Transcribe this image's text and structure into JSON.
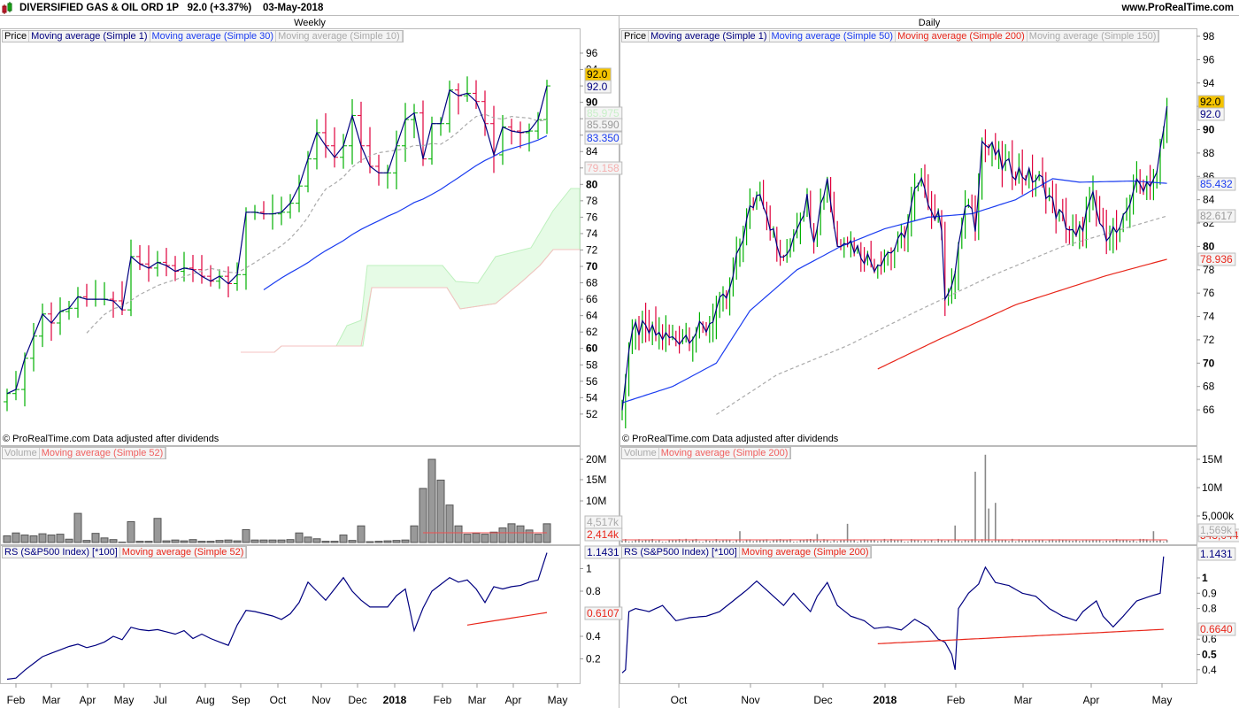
{
  "header": {
    "title": "DIVERSIFIED GAS & OIL ORD 1P",
    "price": "92.0 (+3.37%)",
    "date": "03-May-2018",
    "site": "www.ProRealTime.com"
  },
  "copyright": "© ProRealTime.com  Data adjusted after dividends",
  "colors": {
    "up": "#00b000",
    "down": "#e0003c",
    "ma_close": "#000080",
    "ma_mid": "#1a3cf0",
    "ma_long": "#e8261a",
    "ma_gray": "#aaaaaa",
    "volume": "#999999"
  },
  "weekly": {
    "title": "Weekly",
    "price_legend": [
      "Price",
      "Moving average (Simple 1)",
      "Moving average (Simple 30)",
      "Moving average (Simple 10)"
    ],
    "volume_legend": [
      "Volume",
      "Moving average (Simple 52)"
    ],
    "rs_legend": [
      "RS (S&P500 Index) [*100]",
      "Moving average (Simple 52)"
    ],
    "price_labels": {
      "last": "92.0",
      "ma1": "92.0",
      "cloud_top": "85.975",
      "ma10": "85.590",
      "ma30": "83.350",
      "cloud_bottom": "79.158"
    },
    "volume_labels": {
      "volume": "4,517k",
      "ma": "2,414k"
    },
    "volume_ticks": [
      "20M",
      "15M",
      "10M"
    ],
    "rs_labels": {
      "rs": "1.1431",
      "ma": "0.6107"
    },
    "rs_ticks": [
      "1",
      "0.8",
      "0.4",
      "0.2"
    ],
    "x_ticks": [
      "Feb",
      "Mar",
      "Apr",
      "May",
      "Jul",
      "Aug",
      "Sep",
      "Oct",
      "Nov",
      "Dec",
      "2018",
      "Feb",
      "Mar",
      "Apr",
      "May"
    ]
  },
  "daily": {
    "title": "Daily",
    "price_legend": [
      "Price",
      "Moving average (Simple 1)",
      "Moving average (Simple 50)",
      "Moving average (Simple 200)",
      "Moving average (Simple 150)"
    ],
    "volume_legend": [
      "Volume",
      "Moving average (Simple 200)"
    ],
    "rs_legend": [
      "RS (S&P500 Index) [*100]",
      "Moving average (Simple 200)"
    ],
    "price_labels": {
      "last": "92.0",
      "ma1": "92.0",
      "ma50": "85.432",
      "ma150": "82.617",
      "ma200": "78.936"
    },
    "volume_labels": {
      "volume": "1,569k",
      "ma": "543,044"
    },
    "volume_ticks": [
      "15M",
      "10M",
      "5,000k"
    ],
    "rs_labels": {
      "rs": "1.1431",
      "ma": "0.6640"
    },
    "rs_ticks": [
      "1",
      "0.9",
      "0.8",
      "0.6",
      "0.5",
      "0.4"
    ],
    "x_ticks": [
      "Oct",
      "Nov",
      "Dec",
      "2018",
      "Feb",
      "Mar",
      "Apr",
      "May"
    ]
  },
  "chart_data": [
    {
      "type": "bar",
      "name": "weekly-price",
      "title": "Weekly",
      "ylim": [
        51,
        97
      ],
      "close": [
        54.5,
        55.0,
        58.8,
        61.5,
        64.2,
        63.1,
        64.5,
        64.9,
        66.3,
        66.0,
        66.0,
        66.0,
        65.8,
        64.7,
        71.2,
        70.3,
        69.8,
        70.5,
        70.1,
        69.4,
        69.8,
        69.6,
        68.8,
        68.2,
        68.8,
        67.9,
        69.0,
        76.6,
        76.6,
        76.4,
        76.4,
        76.6,
        77.7,
        79.8,
        83.1,
        86.3,
        84.7,
        83.3,
        84.7,
        88.4,
        84.7,
        82.2,
        81.4,
        81.4,
        84.7,
        87.9,
        88.7,
        83.1,
        87.4,
        87.4,
        91.5,
        90.8,
        91.1,
        90.1,
        87.4,
        83.6,
        87.0,
        86.5,
        86.3,
        86.5,
        87.9,
        92.0
      ],
      "volume_millions": [
        1.6,
        2.3,
        1.8,
        1.6,
        2.1,
        1.8,
        2.0,
        0.8,
        7.0,
        0.5,
        2.2,
        1.1,
        0.7,
        0.1,
        5.0,
        0.3,
        0.3,
        5.8,
        0.4,
        0.6,
        0.4,
        0.7,
        0.3,
        0.3,
        0.5,
        0.6,
        0.4,
        3.1,
        0.6,
        0.6,
        0.6,
        0.6,
        0.7,
        2.3,
        1.3,
        0.9,
        0.3,
        0.3,
        1.8,
        0.5,
        4.0,
        0.2,
        0.3,
        0.4,
        0.5,
        0.6,
        4.0,
        13.0,
        20.0,
        15.0,
        9.0,
        4.0,
        2.0,
        2.2,
        2.0,
        2.5,
        3.5,
        4.5,
        4.0,
        3.0,
        2.0,
        4.5
      ],
      "rs": [
        0.02,
        0.03,
        0.1,
        0.16,
        0.22,
        0.25,
        0.28,
        0.31,
        0.33,
        0.3,
        0.32,
        0.35,
        0.4,
        0.37,
        0.48,
        0.46,
        0.45,
        0.46,
        0.44,
        0.42,
        0.45,
        0.38,
        0.42,
        0.38,
        0.35,
        0.32,
        0.5,
        0.63,
        0.62,
        0.6,
        0.58,
        0.55,
        0.6,
        0.7,
        0.88,
        0.8,
        0.72,
        0.82,
        0.92,
        0.8,
        0.72,
        0.66,
        0.66,
        0.66,
        0.76,
        0.82,
        0.45,
        0.65,
        0.8,
        0.86,
        0.92,
        0.88,
        0.9,
        0.82,
        0.7,
        0.84,
        0.82,
        0.84,
        0.85,
        0.88,
        0.9,
        1.14
      ],
      "rs_ma52_end": [
        0.5,
        0.6107
      ]
    },
    {
      "type": "bar",
      "name": "daily-price",
      "title": "Daily",
      "ylim": [
        64,
        99
      ],
      "close_path": [
        [
          0,
          66.5
        ],
        [
          2,
          71
        ],
        [
          4,
          73
        ],
        [
          10,
          72.5
        ],
        [
          15,
          72
        ],
        [
          20,
          72.5
        ],
        [
          25,
          73
        ],
        [
          28,
          74.5
        ],
        [
          32,
          76
        ],
        [
          35,
          80
        ],
        [
          38,
          83
        ],
        [
          41,
          85
        ],
        [
          44,
          82
        ],
        [
          46,
          80
        ],
        [
          48,
          78.5
        ],
        [
          52,
          82
        ],
        [
          55,
          84
        ],
        [
          57,
          81
        ],
        [
          61,
          86
        ],
        [
          64,
          80
        ],
        [
          66,
          81
        ],
        [
          69,
          80
        ],
        [
          73,
          79
        ],
        [
          75,
          78.5
        ],
        [
          79,
          79.5
        ],
        [
          82,
          80
        ],
        [
          85,
          82
        ],
        [
          87,
          84.5
        ],
        [
          90,
          85.5
        ],
        [
          92,
          83
        ],
        [
          95,
          82
        ],
        [
          96,
          76
        ],
        [
          98,
          76
        ],
        [
          100,
          80
        ],
        [
          103,
          84
        ],
        [
          105,
          82
        ],
        [
          107,
          89
        ],
        [
          111,
          88
        ],
        [
          113,
          87
        ],
        [
          117,
          86.5
        ],
        [
          121,
          86
        ],
        [
          125,
          85.5
        ],
        [
          129,
          83
        ],
        [
          132,
          82
        ],
        [
          135,
          80.5
        ],
        [
          137,
          82
        ],
        [
          140,
          84
        ],
        [
          143,
          81
        ],
        [
          145,
          81.5
        ],
        [
          148,
          81
        ],
        [
          152,
          85
        ],
        [
          156,
          85.5
        ],
        [
          159,
          86
        ],
        [
          162,
          92
        ]
      ],
      "ma50_path": [
        [
          0,
          66.6
        ],
        [
          15,
          68
        ],
        [
          28,
          70
        ],
        [
          38,
          74.5
        ],
        [
          52,
          78
        ],
        [
          65,
          80
        ],
        [
          78,
          81.5
        ],
        [
          91,
          82.5
        ],
        [
          104,
          82.8
        ],
        [
          117,
          84
        ],
        [
          128,
          85.8
        ],
        [
          136,
          85.5
        ],
        [
          152,
          85.6
        ],
        [
          162,
          85.4
        ]
      ],
      "ma150_path": [
        [
          28,
          65.6
        ],
        [
          46,
          69
        ],
        [
          67,
          71.5
        ],
        [
          88,
          74.5
        ],
        [
          110,
          77.5
        ],
        [
          131,
          80
        ],
        [
          162,
          82.6
        ]
      ],
      "ma200_path": [
        [
          76,
          69.5
        ],
        [
          94,
          72
        ],
        [
          117,
          75
        ],
        [
          144,
          77.5
        ],
        [
          162,
          78.9
        ]
      ],
      "volume_spikes_millions": [
        [
          35,
          2
        ],
        [
          58,
          1.5
        ],
        [
          67,
          3.3
        ],
        [
          99,
          3
        ],
        [
          105,
          12.5
        ],
        [
          108,
          15.5
        ],
        [
          109,
          6
        ],
        [
          111,
          7
        ],
        [
          158,
          2
        ]
      ],
      "rs_path": [
        [
          0,
          0.38
        ],
        [
          1,
          0.4
        ],
        [
          2,
          0.78
        ],
        [
          4,
          0.8
        ],
        [
          8,
          0.78
        ],
        [
          12,
          0.82
        ],
        [
          16,
          0.72
        ],
        [
          20,
          0.74
        ],
        [
          25,
          0.75
        ],
        [
          29,
          0.78
        ],
        [
          33,
          0.85
        ],
        [
          37,
          0.92
        ],
        [
          40,
          0.98
        ],
        [
          43,
          0.92
        ],
        [
          45,
          0.88
        ],
        [
          48,
          0.82
        ],
        [
          51,
          0.9
        ],
        [
          53,
          0.85
        ],
        [
          56,
          0.78
        ],
        [
          58,
          0.88
        ],
        [
          61,
          0.97
        ],
        [
          64,
          0.82
        ],
        [
          68,
          0.75
        ],
        [
          72,
          0.72
        ],
        [
          75,
          0.67
        ],
        [
          79,
          0.68
        ],
        [
          83,
          0.66
        ],
        [
          87,
          0.73
        ],
        [
          91,
          0.68
        ],
        [
          94,
          0.6
        ],
        [
          96,
          0.58
        ],
        [
          98,
          0.5
        ],
        [
          99,
          0.4
        ],
        [
          100,
          0.8
        ],
        [
          103,
          0.9
        ],
        [
          106,
          0.96
        ],
        [
          108,
          1.07
        ],
        [
          111,
          0.97
        ],
        [
          115,
          0.95
        ],
        [
          119,
          0.9
        ],
        [
          123,
          0.88
        ],
        [
          127,
          0.8
        ],
        [
          131,
          0.75
        ],
        [
          135,
          0.72
        ],
        [
          137,
          0.78
        ],
        [
          141,
          0.85
        ],
        [
          143,
          0.75
        ],
        [
          146,
          0.68
        ],
        [
          149,
          0.75
        ],
        [
          153,
          0.85
        ],
        [
          157,
          0.88
        ],
        [
          160,
          0.9
        ],
        [
          161,
          1.14
        ]
      ],
      "rs_ma200_path": [
        [
          76,
          0.57
        ],
        [
          161,
          0.664
        ]
      ]
    }
  ]
}
